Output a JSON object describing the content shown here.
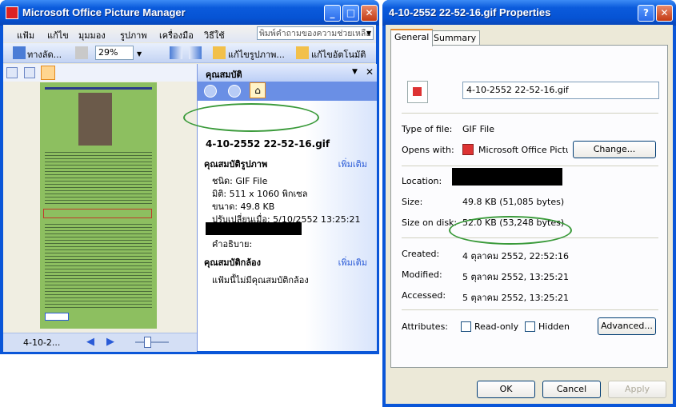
{
  "picture_manager": {
    "title": "Microsoft Office Picture Manager",
    "menu": [
      "แฟ้ม",
      "แก้ไข",
      "มุมมอง",
      "รูปภาพ",
      "เครื่องมือ",
      "วิธีใช้"
    ],
    "help_placeholder": "พิมพ์คำถามของความช่วยเหลือ",
    "toolbar": {
      "shortcuts_label": "ทางลัด...",
      "zoom_value": "29%",
      "edit_picture_label": "แก้ไขรูปภาพ...",
      "auto_correct_label": "แก้ไขอัตโนมัติ"
    },
    "statusbar": {
      "file_label": "4-10-2..."
    },
    "task_pane": {
      "title": "คุณสมบัติ",
      "filename": "4-10-2552 22-52-16.gif",
      "picture_props_heading": "คุณสมบัติรูปภาพ",
      "more_link": "เพิ่มเติม",
      "type": "ชนิด: GIF File",
      "dimensions": "มิติ: 511 x 1060 พิกเซล",
      "size": "ขนาด: 49.8 KB",
      "modified": "ปรับเปลี่ยนเมื่อ: 5/10/2552 13:25:21",
      "description": "คำอธิบาย:",
      "camera_heading": "คุณสมบัติกล้อง",
      "camera_more_link": "เพิ่มเติม",
      "camera_none": "แฟ้มนี้ไม่มีคุณสมบัติกล้อง"
    }
  },
  "properties_dialog": {
    "title": "4-10-2552 22-52-16.gif Properties",
    "tabs": [
      "General",
      "Summary"
    ],
    "filename": "4-10-2552 22-52-16.gif",
    "type_label": "Type of file:",
    "type_value": "GIF File",
    "opens_label": "Opens with:",
    "opens_value": "Microsoft Office Picture",
    "change_button": "Change...",
    "location_label": "Location:",
    "size_label": "Size:",
    "size_value": "49.8 KB (51,085 bytes)",
    "size_disk_label": "Size on disk:",
    "size_disk_value": "52.0 KB (53,248 bytes)",
    "created_label": "Created:",
    "created_value": "4 ตุลาคม 2552, 22:52:16",
    "modified_label": "Modified:",
    "modified_value": "5 ตุลาคม 2552, 13:25:21",
    "accessed_label": "Accessed:",
    "accessed_value": "5 ตุลาคม 2552, 13:25:21",
    "attributes_label": "Attributes:",
    "readonly_label": "Read-only",
    "hidden_label": "Hidden",
    "advanced_button": "Advanced...",
    "ok_button": "OK",
    "cancel_button": "Cancel",
    "apply_button": "Apply"
  },
  "colors": {
    "titlebar": "#0a56d8",
    "highlight_oval": "#3a9a3a",
    "link": "#2a5bd7"
  }
}
